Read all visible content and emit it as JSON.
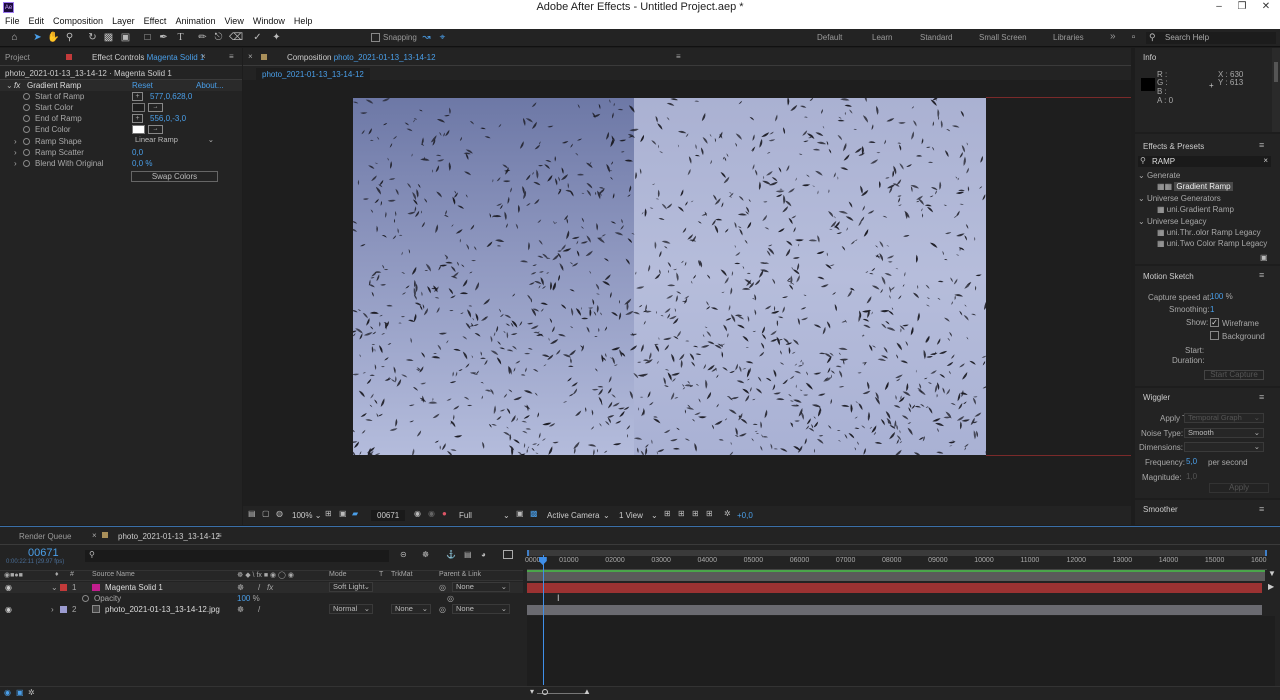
{
  "app": {
    "title": "Adobe After Effects - Untitled Project.aep *",
    "logo": "Ae"
  },
  "menu": [
    "File",
    "Edit",
    "Composition",
    "Layer",
    "Effect",
    "Animation",
    "View",
    "Window",
    "Help"
  ],
  "toolbar": {
    "snapping": "Snapping",
    "workspaces": [
      "Default",
      "Learn",
      "Standard",
      "Small Screen",
      "Libraries"
    ],
    "search_help": "Search Help"
  },
  "left": {
    "tab_project": "Project",
    "tab_effect_controls": "Effect Controls",
    "ec_layer": "Magenta Solid 1",
    "ec_subtitle": "photo_2021-01-13_13-14-12 · Magenta Solid 1",
    "effect_name": "Gradient Ramp",
    "reset": "Reset",
    "about": "About...",
    "props": [
      {
        "name": "Start of Ramp",
        "value": "577,0,628,0"
      },
      {
        "name": "Start Color",
        "value": ""
      },
      {
        "name": "End of Ramp",
        "value": "556,0,-3,0"
      },
      {
        "name": "End Color",
        "value": ""
      },
      {
        "name": "Ramp Shape",
        "value": "Linear Ramp"
      },
      {
        "name": "Ramp Scatter",
        "value": "0,0"
      },
      {
        "name": "Blend With Original",
        "value": "0,0 %"
      }
    ],
    "swap": "Swap Colors"
  },
  "comp": {
    "tab_label": "Composition",
    "tab_name": "photo_2021-01-13_13-14-12",
    "sub_tab": "photo_2021-01-13_13-14-12",
    "zoom": "100%",
    "timecode": "00671",
    "resolution": "Full",
    "camera": "Active Camera",
    "views": "1 View",
    "exposure": "+0,0"
  },
  "info": {
    "title": "Info",
    "R": "R :",
    "G": "G :",
    "B": "B :",
    "A": "A : 0",
    "X": "X : 630",
    "Y": "Y : 613"
  },
  "effects_presets": {
    "title": "Effects & Presets",
    "search": "RAMP",
    "groups": [
      {
        "name": "Generate",
        "items": [
          "Gradient Ramp"
        ]
      },
      {
        "name": "Universe Generators",
        "items": [
          "uni.Gradient Ramp"
        ]
      },
      {
        "name": "Universe Legacy",
        "items": [
          "uni.Thr..olor Ramp Legacy",
          "uni.Two Color Ramp Legacy"
        ]
      }
    ]
  },
  "motion_sketch": {
    "title": "Motion Sketch",
    "capture_label": "Capture speed at:",
    "capture_value": "100",
    "capture_unit": "%",
    "smoothing_label": "Smoothing:",
    "smoothing_value": "1",
    "show_label": "Show:",
    "wireframe": "Wireframe",
    "background": "Background",
    "start": "Start:",
    "duration": "Duration:",
    "button": "Start Capture"
  },
  "wiggler": {
    "title": "Wiggler",
    "apply_to_label": "Apply To:",
    "apply_to": "Temporal Graph",
    "noise_label": "Noise Type:",
    "noise": "Smooth",
    "dimensions_label": "Dimensions:",
    "frequency_label": "Frequency:",
    "frequency": "5,0",
    "per_second": "per second",
    "magnitude_label": "Magnitude:",
    "magnitude": "1,0",
    "apply": "Apply"
  },
  "smoother": {
    "title": "Smoother"
  },
  "timeline": {
    "render_queue": "Render Queue",
    "comp_tab": "photo_2021-01-13_13-14-12",
    "timecode": "00671",
    "timecode_sub": "0:00:22:11 (29.97 fps)",
    "headers": {
      "source": "Source Name",
      "mode": "Mode",
      "t": "T",
      "trkmat": "TrkMat",
      "parent": "Parent & Link"
    },
    "layers": [
      {
        "num": "1",
        "name": "Magenta Solid 1",
        "mode": "Soft Light",
        "trkmat": "",
        "parent": "None",
        "label": "#c21e8e"
      },
      {
        "num": "2",
        "name": "photo_2021-01-13_13-14-12.jpg",
        "mode": "Normal",
        "trkmat": "None",
        "parent": "None",
        "label": "#9b9bd0"
      }
    ],
    "opacity_label": "Opacity",
    "opacity_value": "100",
    "opacity_unit": "%",
    "ruler": [
      "00000",
      "01000",
      "02000",
      "03000",
      "04000",
      "05000",
      "06000",
      "07000",
      "08000",
      "09000",
      "10000",
      "11000",
      "12000",
      "13000",
      "14000",
      "15000",
      "1600"
    ],
    "current_time_fraction": 0.0214
  }
}
